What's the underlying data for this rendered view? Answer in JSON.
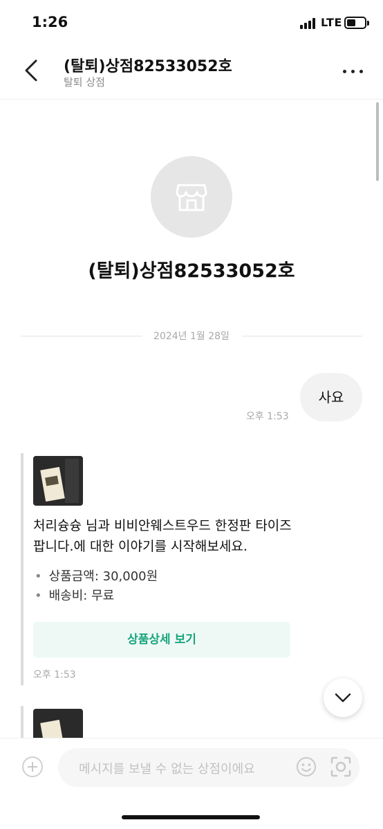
{
  "status_bar": {
    "time": "1:26",
    "network": "LTE"
  },
  "header": {
    "title": "(탈퇴)상점82533052호",
    "subtitle": "탈퇴 상점"
  },
  "profile": {
    "name": "(탈퇴)상점82533052호"
  },
  "chat": {
    "date": "2024년 1월 28일",
    "outgoing": {
      "text": "사요",
      "time": "오후 1:53"
    },
    "product_card": {
      "intro": "처리슝슝 님과 비비안웨스트우드 한정판 타이즈팝니다.에 대한 이야기를 시작해보세요.",
      "price": "상품금액: 30,000원",
      "shipping": "배송비: 무료",
      "detail_button": "상품상세 보기",
      "time": "오후 1:53"
    }
  },
  "input": {
    "placeholder": "메시지를 보낼 수 없는 상점이에요"
  },
  "colors": {
    "accent": "#1aa57c",
    "detail_bg": "#eef9f6",
    "bubble": "#f2f2f2"
  },
  "icons": {
    "back": "chevron-left-icon",
    "more": "more-dots-icon",
    "shop": "storefront-icon",
    "scroll": "chevron-down-icon",
    "plus": "plus-icon",
    "emoji": "smile-icon",
    "camera": "camera-icon"
  }
}
